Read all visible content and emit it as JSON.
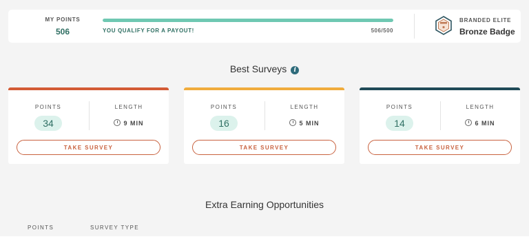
{
  "points": {
    "label": "MY POINTS",
    "value": "506",
    "qualify_text": "YOU QUALIFY FOR A PAYOUT!",
    "progress_text": "506/500",
    "progress_fraction": 1.0
  },
  "badge": {
    "tier": "BRANDED ELITE",
    "name": "Bronze Badge",
    "icon": "hexagon-badge-icon"
  },
  "best_surveys": {
    "title": "Best Surveys",
    "info_icon": "i",
    "cards": [
      {
        "points_label": "POINTS",
        "length_label": "LENGTH",
        "points": "34",
        "length": "9 MIN",
        "button": "TAKE SURVEY",
        "accent": "#d35b35"
      },
      {
        "points_label": "POINTS",
        "length_label": "LENGTH",
        "points": "16",
        "length": "5 MIN",
        "button": "TAKE SURVEY",
        "accent": "#f0ac3c"
      },
      {
        "points_label": "POINTS",
        "length_label": "LENGTH",
        "points": "14",
        "length": "6 MIN",
        "button": "TAKE SURVEY",
        "accent": "#1f4a57"
      }
    ]
  },
  "extra": {
    "title": "Extra Earning Opportunities",
    "columns": [
      "POINTS",
      "SURVEY TYPE"
    ]
  },
  "colors": {
    "teal": "#6fc8b2",
    "button_orange": "#c8613e"
  }
}
